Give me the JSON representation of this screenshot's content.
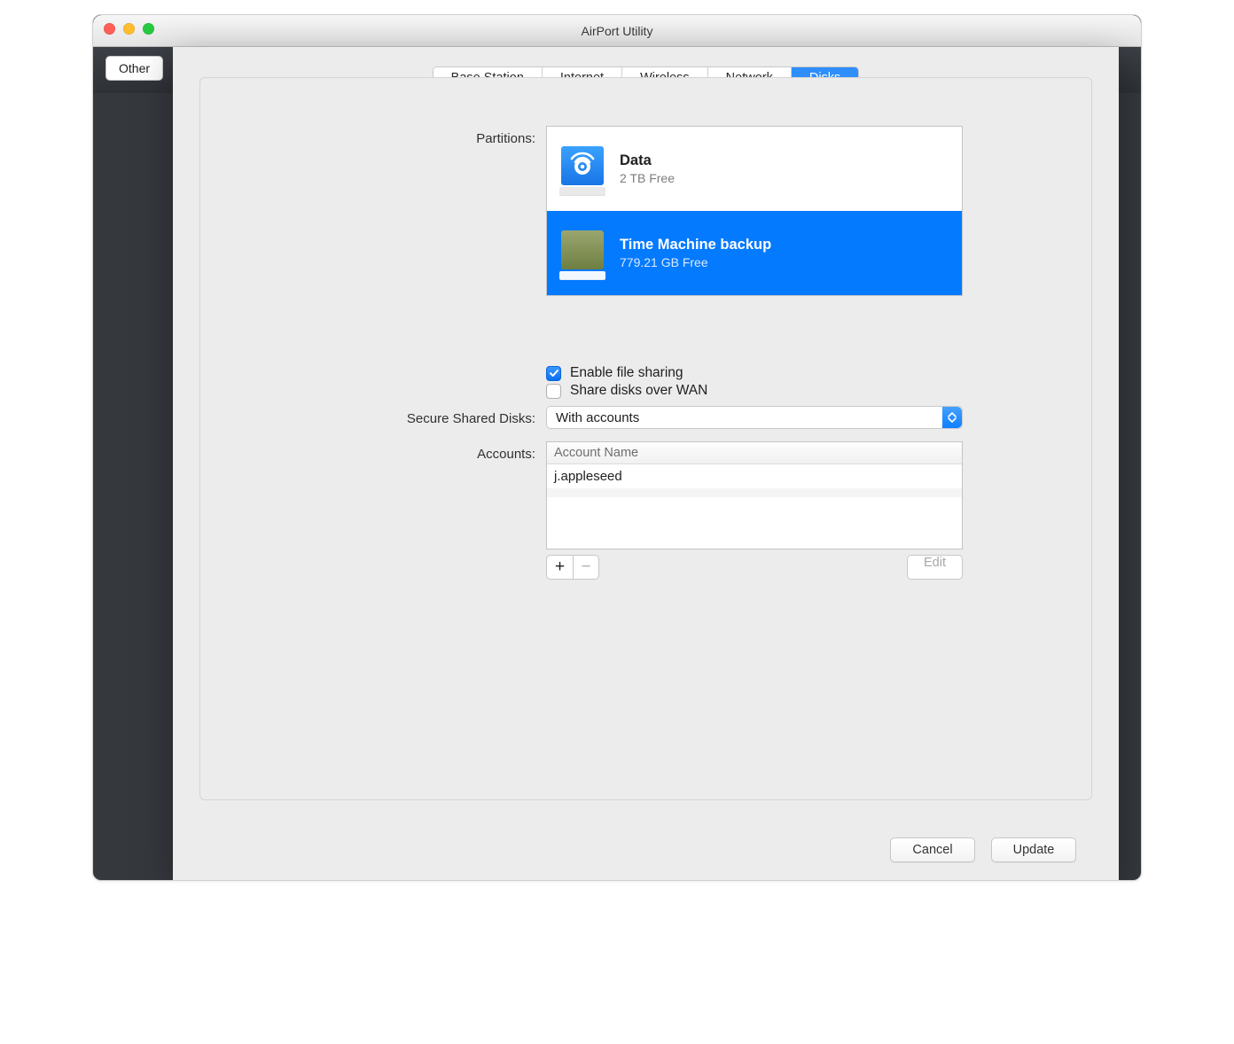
{
  "window": {
    "title": "AirPort Utility"
  },
  "backgroundToolbar": {
    "other": "Other"
  },
  "tabs": [
    "Base Station",
    "Internet",
    "Wireless",
    "Network",
    "Disks"
  ],
  "selectedTab": "Disks",
  "labels": {
    "partitions": "Partitions:",
    "secureSharedDisks": "Secure Shared Disks:",
    "accounts": "Accounts:"
  },
  "partitions": [
    {
      "name": "Data",
      "free": "2 TB Free",
      "iconType": "wifi",
      "selected": false
    },
    {
      "name": "Time Machine backup",
      "free": "779.21 GB Free",
      "iconType": "green",
      "selected": true
    }
  ],
  "checkboxes": {
    "enableFileSharing": {
      "label": "Enable file sharing",
      "checked": true
    },
    "shareOverWan": {
      "label": "Share disks over WAN",
      "checked": false
    }
  },
  "secureSharedDisks": {
    "value": "With accounts"
  },
  "accountsTable": {
    "header": "Account Name",
    "rows": [
      "j.appleseed"
    ]
  },
  "buttons": {
    "edit": "Edit",
    "cancel": "Cancel",
    "update": "Update"
  }
}
